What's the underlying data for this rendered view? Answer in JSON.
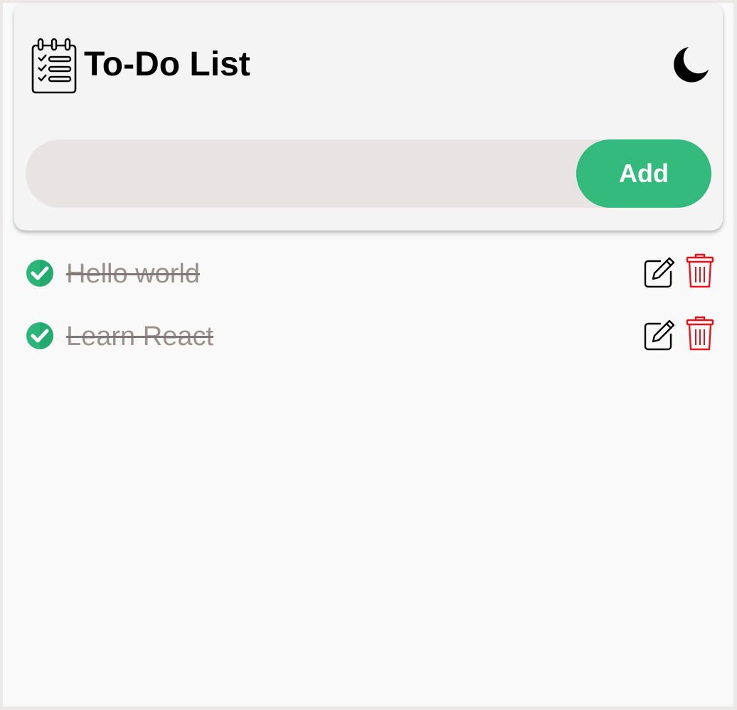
{
  "header": {
    "title": "To-Do List",
    "app_icon": "checklist-notepad-icon",
    "theme_toggle_icon": "moon-icon"
  },
  "new_task": {
    "value": "",
    "placeholder": "",
    "add_label": "Add"
  },
  "tasks": [
    {
      "text": "Hello world",
      "completed": true,
      "icons": [
        "check-circle-icon",
        "edit-icon",
        "trash-icon"
      ]
    },
    {
      "text": "Learn React",
      "completed": true,
      "icons": [
        "check-circle-icon",
        "edit-icon",
        "trash-icon"
      ]
    }
  ],
  "colors": {
    "accent": "#33ba7c",
    "delete": "#e8141b",
    "completed_text": "#9a918f",
    "card": "#f4f4f4",
    "input_bg": "#e7e4e3"
  }
}
